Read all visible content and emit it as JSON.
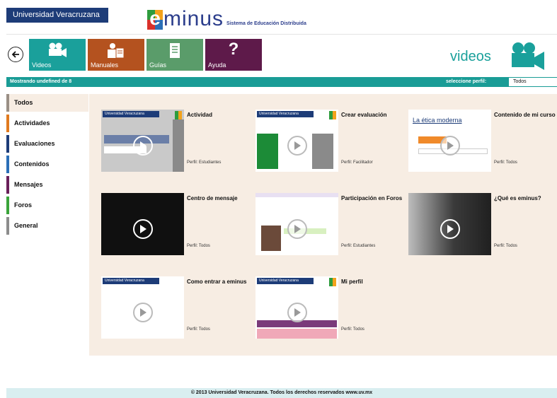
{
  "header": {
    "university": "Universidad Veracruzana",
    "logo_letter": "e",
    "logo_word": "minus",
    "logo_subtitle": "Sistema de Educación Distribuida"
  },
  "toolbar": {
    "tiles": [
      {
        "label": "Videos",
        "icon": "video-camera-icon",
        "color": "#1aa09b"
      },
      {
        "label": "Manuales",
        "icon": "manual-icon",
        "color": "#b4521f"
      },
      {
        "label": "Guías",
        "icon": "guide-icon",
        "color": "#5a9c6a"
      },
      {
        "label": "Ayuda",
        "icon": "question-icon",
        "color": "#5e1a4a",
        "symbol": "?"
      }
    ],
    "section_title": "videos"
  },
  "bar": {
    "showing_text": "Mostrando undefined de 8",
    "profile_label": "seleccione perfil:",
    "profile_value": "Todos",
    "select_arrow": "⬍"
  },
  "menu": [
    {
      "label": "Todos",
      "color": "#9a8f86"
    },
    {
      "label": "Actividades",
      "color": "#e07a1f"
    },
    {
      "label": "Evaluaciones",
      "color": "#1d3c78"
    },
    {
      "label": "Contenidos",
      "color": "#2b6fb7"
    },
    {
      "label": "Mensajes",
      "color": "#6a1f5a"
    },
    {
      "label": "Foros",
      "color": "#3aa43a"
    },
    {
      "label": "General",
      "color": "#8c8c8c"
    }
  ],
  "videos": [
    {
      "title": "Actividad",
      "profile": "Perfil: Estudiantes",
      "thumb_text": "Universidad Veracruzana"
    },
    {
      "title": "Crear evaluación",
      "profile": "Perfil: Facilitador",
      "thumb_text": "Universidad Veracruzana"
    },
    {
      "title": "Contenido de mi curso",
      "profile": "Perfil: Todos",
      "thumb_text": "La ética moderna"
    },
    {
      "title": "Centro de mensaje",
      "profile": "Perfil: Todos"
    },
    {
      "title": "Participación en Foros",
      "profile": "Perfil: Estudiantes"
    },
    {
      "title": "¿Qué es eminus?",
      "profile": "Perfil: Todos"
    },
    {
      "title": "Como entrar a eminus",
      "profile": "Perfil: Todos",
      "thumb_text": "Universidad Veracruzana"
    },
    {
      "title": "Mi perfil",
      "profile": "Perfil: Todos",
      "thumb_text": "Universidad Veracruzana"
    }
  ],
  "footer": "© 2013 Universidad Veracruzana. Todos los derechos reservados www.uv.mx"
}
